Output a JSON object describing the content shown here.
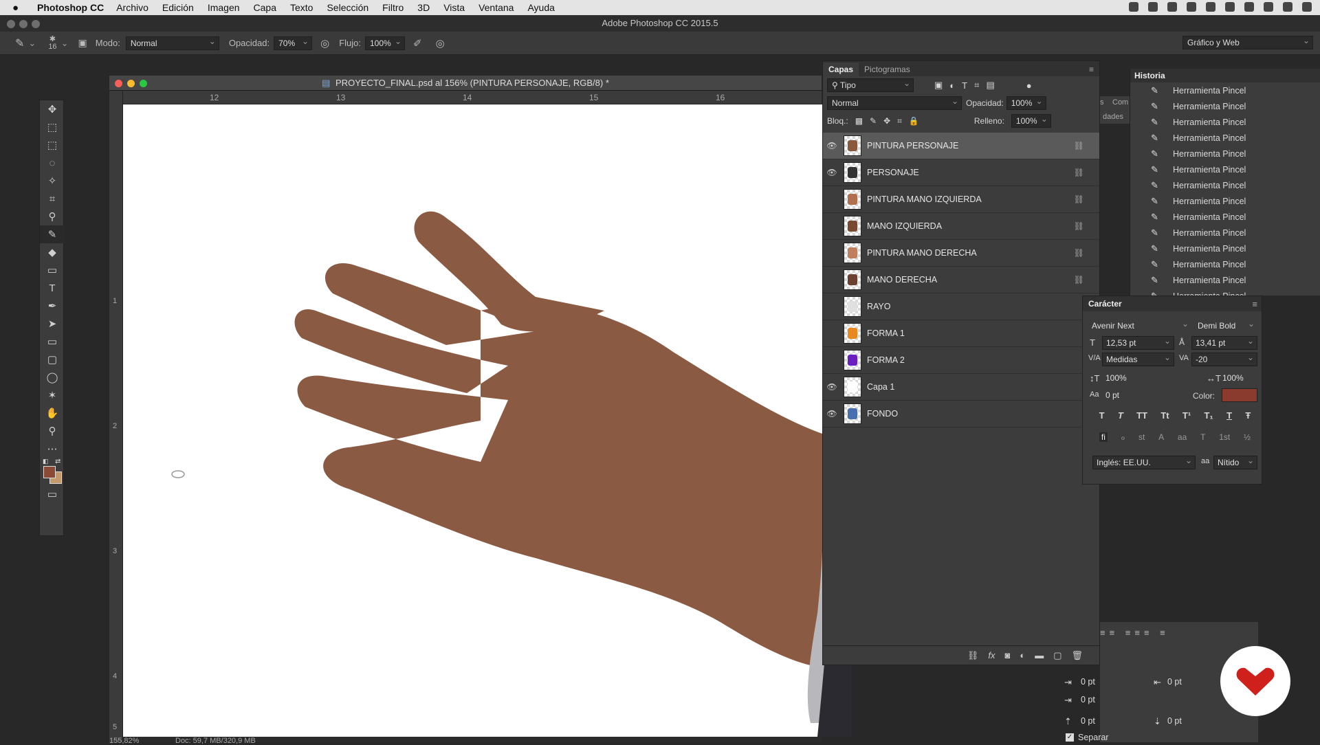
{
  "menubar": {
    "app": "Photoshop CC",
    "items": [
      "Archivo",
      "Edición",
      "Imagen",
      "Capa",
      "Texto",
      "Selección",
      "Filtro",
      "3D",
      "Vista",
      "Ventana",
      "Ayuda"
    ]
  },
  "app_title": "Adobe Photoshop CC 2015.5",
  "options": {
    "brush_size": "16",
    "mode_label": "Modo:",
    "mode_value": "Normal",
    "opacity_label": "Opacidad:",
    "opacity_value": "70%",
    "flow_label": "Flujo:",
    "flow_value": "100%",
    "workspace": "Gráfico y Web"
  },
  "document": {
    "title": "PROYECTO_FINAL.psd al 156% (PINTURA PERSONAJE, RGB/8) *",
    "ruler_top": [
      "12",
      "13",
      "14",
      "15",
      "16"
    ],
    "ruler_left": [
      "1",
      "2",
      "3",
      "4",
      "5"
    ],
    "zoom": "155,82%",
    "doc_info": "Doc: 59,7 MB/320,9 MB"
  },
  "layers": {
    "tabs": [
      "Capas",
      "Pictogramas"
    ],
    "filter": "Tipo",
    "blend": "Normal",
    "opacity_label": "Opacidad:",
    "opacity_value": "100%",
    "lock_label": "Bloq.:",
    "fill_label": "Relleno:",
    "fill_value": "100%",
    "items": [
      {
        "name": "PINTURA PERSONAJE",
        "visible": true,
        "selected": true,
        "linked": true,
        "thumb": "#8b5a3c"
      },
      {
        "name": "PERSONAJE",
        "visible": true,
        "selected": false,
        "linked": true,
        "thumb": "#333333"
      },
      {
        "name": "PINTURA MANO IZQUIERDA",
        "visible": false,
        "selected": false,
        "linked": true,
        "thumb": "#b07050"
      },
      {
        "name": "MANO IZQUIERDA",
        "visible": false,
        "selected": false,
        "linked": true,
        "thumb": "#7a4a30"
      },
      {
        "name": "PINTURA MANO DERECHA",
        "visible": false,
        "selected": false,
        "linked": true,
        "thumb": "#c08060"
      },
      {
        "name": "MANO DERECHA",
        "visible": false,
        "selected": false,
        "linked": true,
        "thumb": "#6b4030"
      },
      {
        "name": "RAYO",
        "visible": false,
        "selected": false,
        "linked": false,
        "thumb": "#e0e0e0"
      },
      {
        "name": "FORMA 1",
        "visible": false,
        "selected": false,
        "linked": false,
        "thumb": "#e88a20"
      },
      {
        "name": "FORMA 2",
        "visible": false,
        "selected": false,
        "linked": false,
        "thumb": "#6a1fc0"
      },
      {
        "name": "Capa 1",
        "visible": true,
        "selected": false,
        "linked": false,
        "thumb": "#ffffff"
      },
      {
        "name": "FONDO",
        "visible": true,
        "selected": false,
        "linked": false,
        "thumb": "#4a6fb0"
      }
    ]
  },
  "side_tabs": {
    "a": "s",
    "b": "Com",
    "c": "dades"
  },
  "historia": {
    "title": "Historia",
    "items": [
      "Herramienta Pincel",
      "Herramienta Pincel",
      "Herramienta Pincel",
      "Herramienta Pincel",
      "Herramienta Pincel",
      "Herramienta Pincel",
      "Herramienta Pincel",
      "Herramienta Pincel",
      "Herramienta Pincel",
      "Herramienta Pincel",
      "Herramienta Pincel",
      "Herramienta Pincel",
      "Herramienta Pincel",
      "Herramienta Pincel"
    ]
  },
  "caracter": {
    "title": "Carácter",
    "font_family": "Avenir Next",
    "font_style": "Demi Bold",
    "size": "12,53 pt",
    "leading": "13,41 pt",
    "kerning": "Medidas",
    "tracking": "-20",
    "vscale": "100%",
    "hscale": "100%",
    "baseline": "0 pt",
    "color_label": "Color:",
    "color": "#8a3b2e",
    "language": "Inglés: EE.UU.",
    "aa_label": "aa",
    "antialias": "Nítido",
    "style_buttons": [
      "T",
      "T",
      "TT",
      "Tt",
      "T¹",
      "T₁",
      "T",
      "Ŧ"
    ],
    "opentype_buttons": [
      "fi",
      "ℴ",
      "st",
      "A",
      "aa",
      "T",
      "1st",
      "½"
    ]
  },
  "paragraph": {
    "indent_left": "0 pt",
    "indent_right": "0 pt",
    "first_line": "0 pt",
    "space_before": "0 pt",
    "space_after": "0 pt",
    "hyphen_label": "Separar"
  },
  "colors": {
    "foreground": "#8a4a35",
    "background": "#c59a6a",
    "skin": "#8b5a43",
    "logo": "#d0201c"
  }
}
